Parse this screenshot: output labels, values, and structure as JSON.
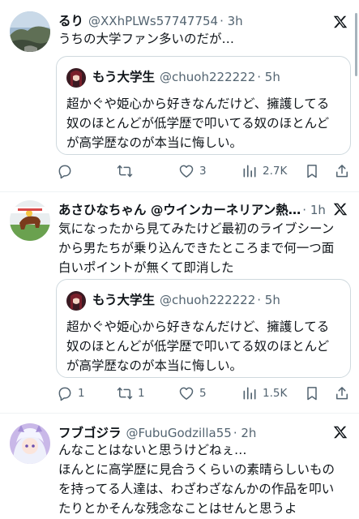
{
  "tweets": [
    {
      "name": "るり",
      "handle": "@XXhPLWs57747754",
      "time": "· 3h",
      "text": "うちの大学ファン多いのだが…",
      "quote": {
        "name": "もう大学生",
        "handle": "@chuoh222222",
        "time": "· 5h",
        "lines": [
          "超かぐや姫心から好きなんだけど、擁護してる",
          "奴のほとんどが低学歴で叩いてる奴のほとんど",
          "が高学歴なのが本当に悔しい。"
        ]
      },
      "actions": {
        "replies": "",
        "retweets": "",
        "likes": "3",
        "views": "2.7K"
      }
    },
    {
      "name": "あさひなちゃん @ウインカーネリアン熱…",
      "handle": "",
      "time": "· 1h",
      "lines": [
        "気になったから見てみたけど最初のライブシーン",
        "から男たちが乗り込んできたところまで何一つ面",
        "白いポイントが無くて即消した"
      ],
      "quote": {
        "name": "もう大学生",
        "handle": "@chuoh222222",
        "time": "· 5h",
        "lines": [
          "超かぐや姫心から好きなんだけど、擁護してる",
          "奴のほとんどが低学歴で叩いてる奴のほとんど",
          "が高学歴なのが本当に悔しい。"
        ]
      },
      "actions": {
        "replies": "1",
        "retweets": "1",
        "likes": "5",
        "views": "1.5K"
      }
    },
    {
      "name": "フブゴジラ",
      "handle": "@FubuGodzilla55",
      "time": "· 2h",
      "lines": [
        "んなことはないと思うけどねぇ…",
        "ほんとに高学歴に見合うくらいの素晴らしいもの",
        "を持ってる人達は、わざわざなんかの作品を叩い",
        "たりとかそんな残念なことはせんと思うよ"
      ]
    }
  ],
  "colors": {
    "text": "#0f1419",
    "secondary": "#536471",
    "border": "#cfd9de"
  },
  "icons": [
    "x-logo-icon",
    "reply-icon",
    "retweet-icon",
    "like-icon",
    "views-icon",
    "bookmark-icon",
    "share-icon"
  ]
}
